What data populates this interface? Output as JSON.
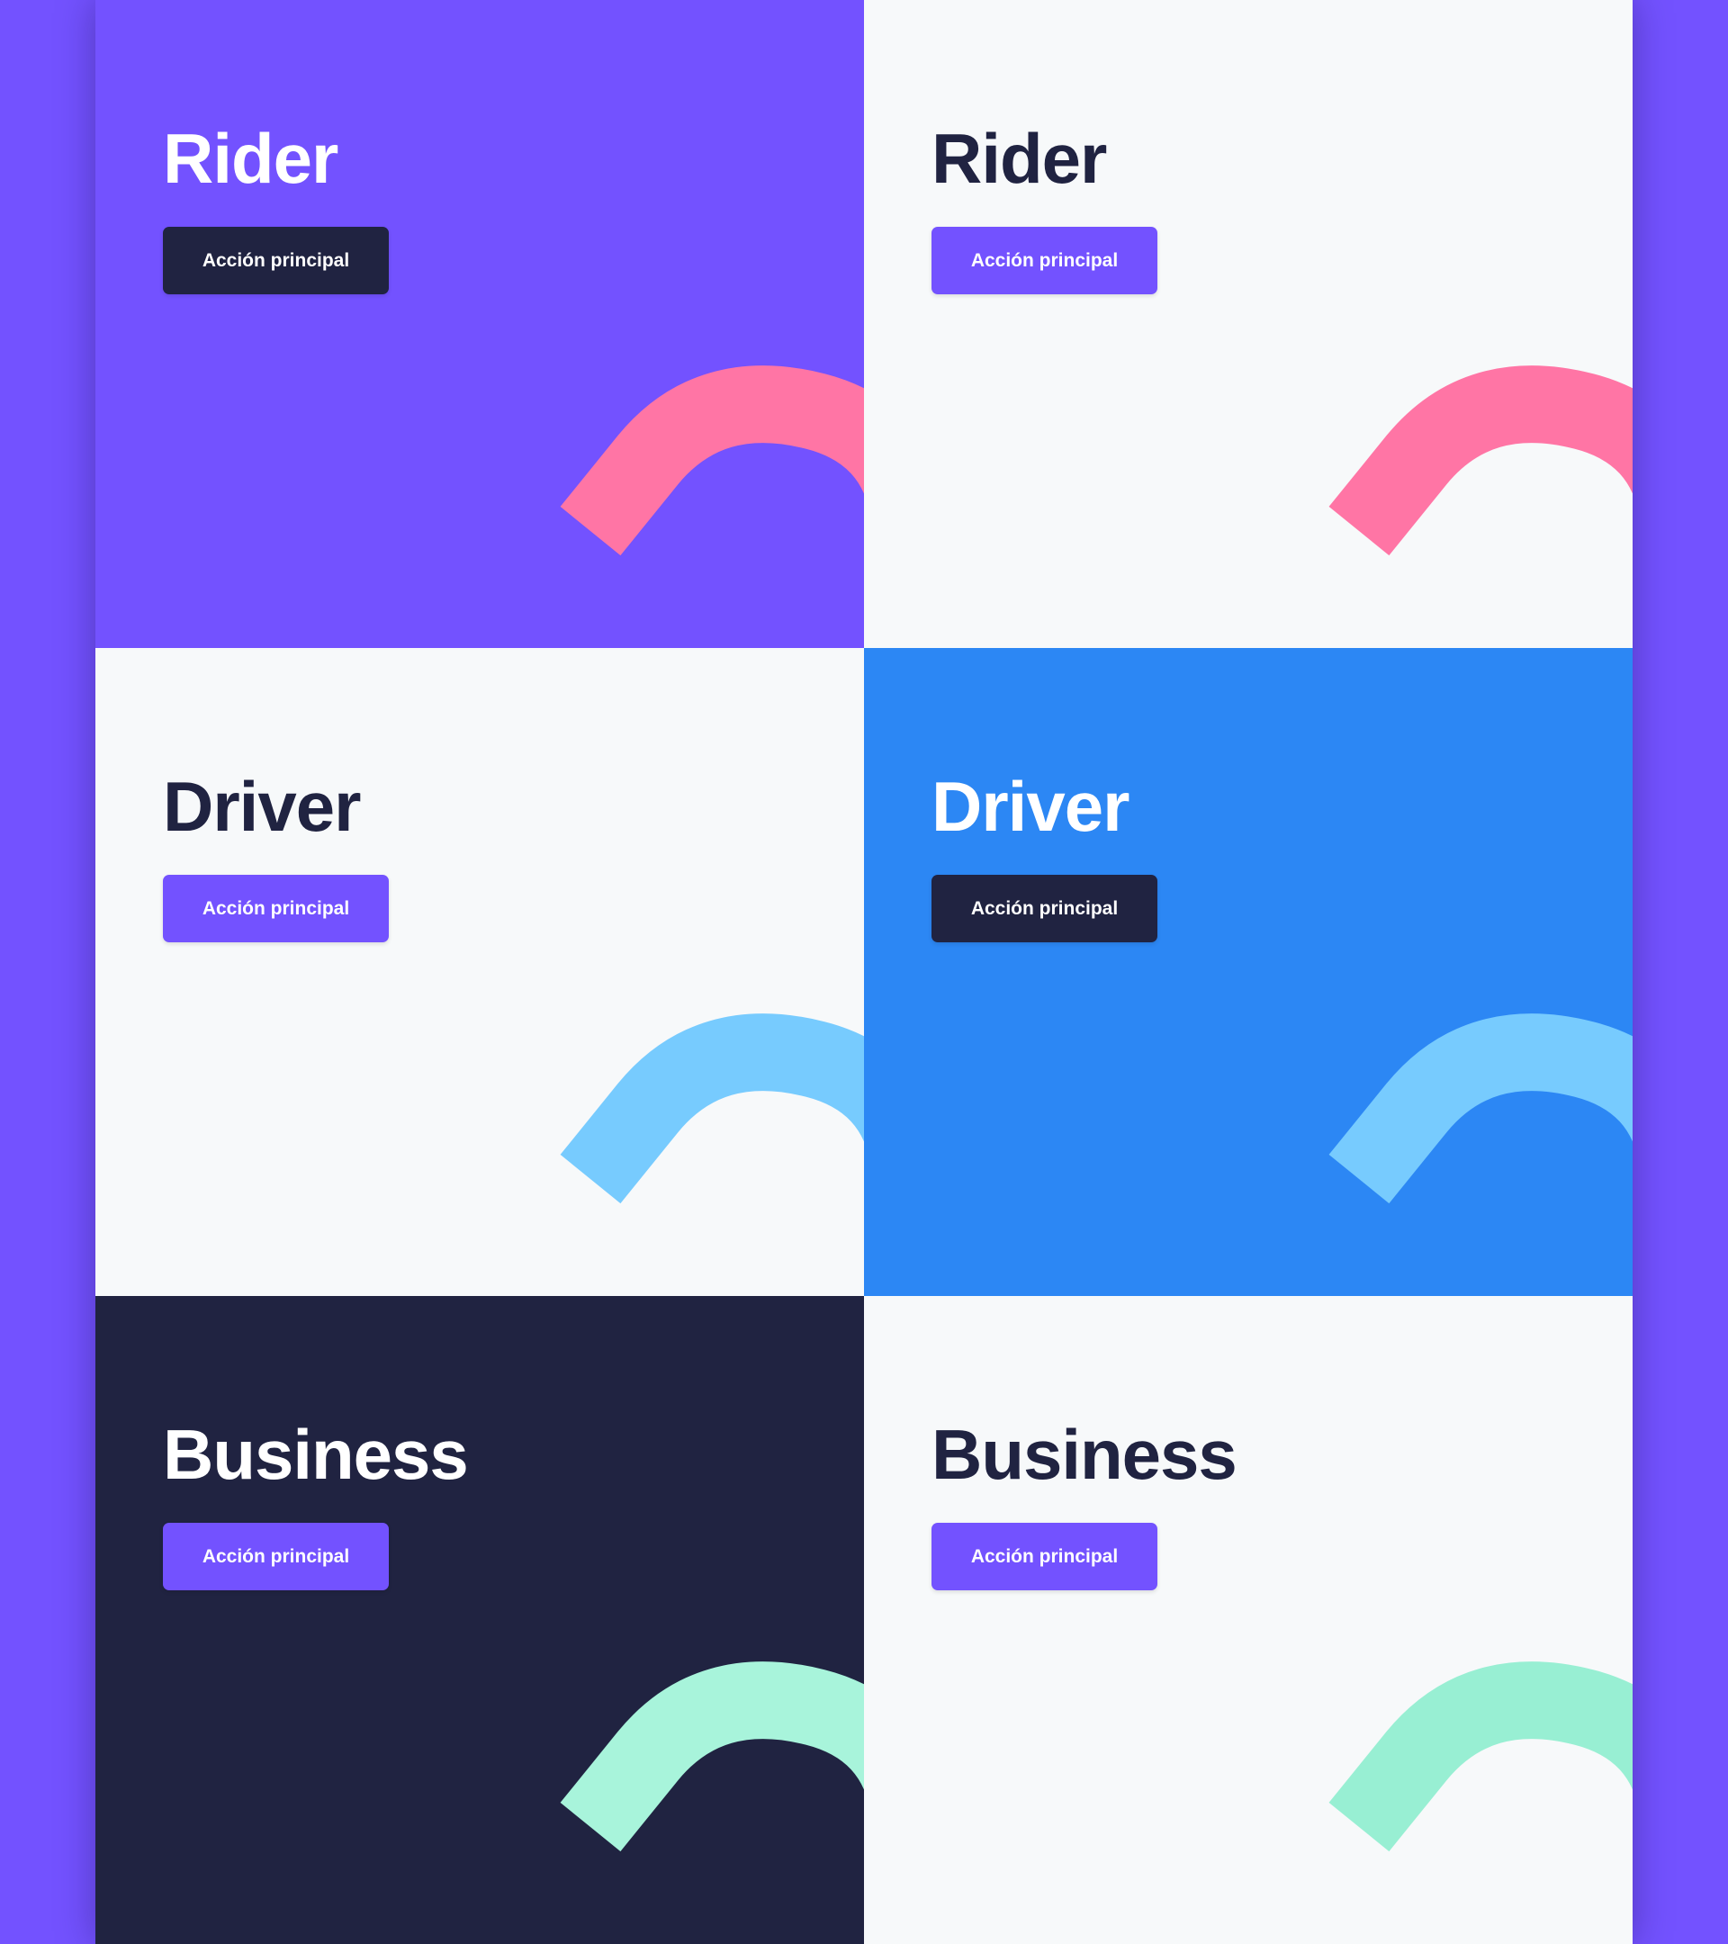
{
  "colors": {
    "page_background": "#7352FF",
    "purple": "#7352FF",
    "navy": "#202341",
    "light": "#F7F9FA",
    "blue": "#2C87F4",
    "pink": "#FF75A5",
    "sky": "#77CBFE",
    "mint": "#A8F4DB"
  },
  "cards": [
    {
      "title": "Rider",
      "button_label": "Acción principal",
      "background": "#7352FF",
      "title_color": "#FFFFFF",
      "button_color": "#202341",
      "accent_color": "#FF75A5",
      "accent_icon": "wave-shape-icon"
    },
    {
      "title": "Rider",
      "button_label": "Acción principal",
      "background": "#F7F9FA",
      "title_color": "#202341",
      "button_color": "#7352FF",
      "accent_color": "#FF75A5",
      "accent_icon": "wave-shape-icon"
    },
    {
      "title": "Driver",
      "button_label": "Acción principal",
      "background": "#F7F9FA",
      "title_color": "#202341",
      "button_color": "#7352FF",
      "accent_color": "#77CBFE",
      "accent_icon": "wave-shape-icon"
    },
    {
      "title": "Driver",
      "button_label": "Acción principal",
      "background": "#2C87F4",
      "title_color": "#FFFFFF",
      "button_color": "#202341",
      "accent_color": "#77CBFE",
      "accent_icon": "wave-shape-icon"
    },
    {
      "title": "Business",
      "button_label": "Acción principal",
      "background": "#202341",
      "title_color": "#FFFFFF",
      "button_color": "#7352FF",
      "accent_color": "#A8F4DB",
      "accent_icon": "wave-shape-icon"
    },
    {
      "title": "Business",
      "button_label": "Acción principal",
      "background": "#F7F9FA",
      "title_color": "#202341",
      "button_color": "#7352FF",
      "accent_color": "#98EFD3",
      "accent_icon": "wave-shape-icon"
    }
  ]
}
